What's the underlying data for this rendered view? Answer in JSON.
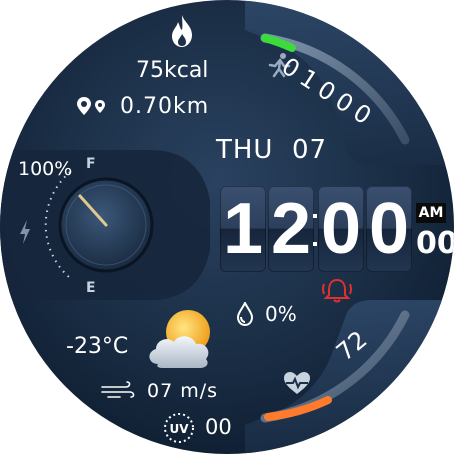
{
  "activity": {
    "calories": "75kcal",
    "distance": "0.70km"
  },
  "date": {
    "day": "THU",
    "date": "07"
  },
  "battery": {
    "percent_label": "100%",
    "full_label": "F",
    "empty_label": "E",
    "level": 1.0
  },
  "time": {
    "hour_digits": [
      "1",
      "2"
    ],
    "minute_digits": [
      "0",
      "0"
    ],
    "ampm": "AM",
    "seconds": "00"
  },
  "steps": {
    "value": "01000",
    "progress": 0.1
  },
  "heart": {
    "value": "72",
    "progress": 0.35
  },
  "weather": {
    "temperature": "-23°C",
    "humidity": "0%",
    "wind": "07  m/s",
    "uv": "00"
  },
  "colors": {
    "steps_bar": "#3ddc3d",
    "heart_bar": "#ff7a2a",
    "alarm": "#e03030",
    "accent_needle": "#f3e3b0"
  },
  "icons": [
    "fire-icon",
    "location-icon",
    "running-icon",
    "bolt-icon",
    "alarm-icon",
    "droplet-icon",
    "weather-icon",
    "wind-icon",
    "uv-icon",
    "heart-rate-icon"
  ]
}
